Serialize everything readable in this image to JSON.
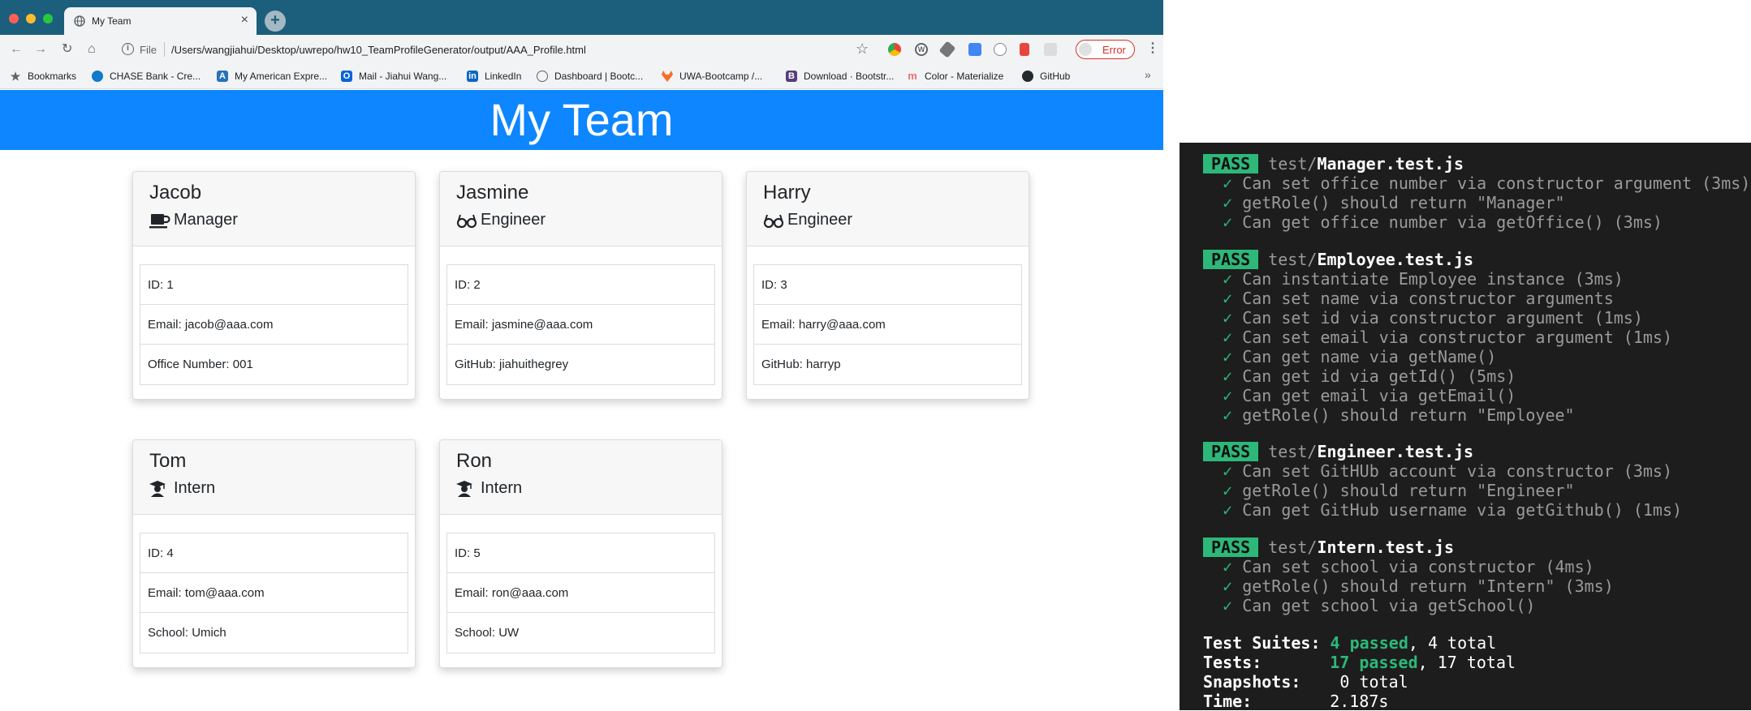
{
  "browser": {
    "tab_title": "My Team",
    "new_tab_label": "+",
    "file_label": "File",
    "url": "/Users/wangjiahui/Desktop/uwrepo/hw10_TeamProfileGenerator/output/AAA_Profile.html",
    "error_label": "Error",
    "bookmarks": [
      {
        "label": "Bookmarks",
        "icon": "star-icon",
        "color": "#5f6368"
      },
      {
        "label": "CHASE Bank - Cre...",
        "icon": "chase-icon",
        "color": "#117aca"
      },
      {
        "label": "My American Expre...",
        "icon": "amex-icon",
        "color": "#2671b9"
      },
      {
        "label": "Mail - Jiahui Wang...",
        "icon": "outlook-icon",
        "color": "#0a64d6"
      },
      {
        "label": "LinkedIn",
        "icon": "linkedin-icon",
        "color": "#0a66c2"
      },
      {
        "label": "Dashboard | Bootc...",
        "icon": "globe-icon",
        "color": "#5f6368"
      },
      {
        "label": "UWA-Bootcamp /...",
        "icon": "gitlab-icon",
        "color": "#fc6d26"
      },
      {
        "label": "Download · Bootstr...",
        "icon": "bootstrap-icon",
        "color": "#563d7c"
      },
      {
        "label": "Color - Materialize",
        "icon": "materialize-icon",
        "color": "#ee6e73"
      },
      {
        "label": "GitHub",
        "icon": "github-icon",
        "color": "#24292e"
      }
    ],
    "more_label": "»"
  },
  "page": {
    "title": "My Team",
    "header_color": "#0d86ff"
  },
  "team": [
    {
      "name": "Jacob",
      "role": "Manager",
      "icon": "coffee-mug-icon",
      "id_line": "ID: 1",
      "email_line": "Email: jacob@aaa.com",
      "extra_line": "Office Number: 001"
    },
    {
      "name": "Jasmine",
      "role": "Engineer",
      "icon": "glasses-icon",
      "id_line": "ID: 2",
      "email_line": "Email: jasmine@aaa.com",
      "extra_line": "GitHub: jiahuithegrey"
    },
    {
      "name": "Harry",
      "role": "Engineer",
      "icon": "glasses-icon",
      "id_line": "ID: 3",
      "email_line": "Email: harry@aaa.com",
      "extra_line": "GitHub: harryp"
    },
    {
      "name": "Tom",
      "role": "Intern",
      "icon": "graduate-icon",
      "id_line": "ID: 4",
      "email_line": "Email: tom@aaa.com",
      "extra_line": "School: Umich"
    },
    {
      "name": "Ron",
      "role": "Intern",
      "icon": "graduate-icon",
      "id_line": "ID: 5",
      "email_line": "Email: ron@aaa.com",
      "extra_line": "School: UW"
    }
  ],
  "terminal": {
    "suites": [
      {
        "badge": "PASS",
        "dir": "test/",
        "file": "Manager.test.js",
        "tests": [
          "Can set office number via constructor argument (3ms)",
          "getRole() should return \"Manager\"",
          "Can get office number via getOffice() (3ms)"
        ]
      },
      {
        "badge": "PASS",
        "dir": "test/",
        "file": "Employee.test.js",
        "tests": [
          "Can instantiate Employee instance (3ms)",
          "Can set name via constructor arguments",
          "Can set id via constructor argument (1ms)",
          "Can set email via constructor argument (1ms)",
          "Can get name via getName()",
          "Can get id via getId() (5ms)",
          "Can get email via getEmail()",
          "getRole() should return \"Employee\""
        ]
      },
      {
        "badge": "PASS",
        "dir": "test/",
        "file": "Engineer.test.js",
        "tests": [
          "Can set GitHUb account via constructor (3ms)",
          "getRole() should return \"Engineer\"",
          "Can get GitHub username via getGithub() (1ms)"
        ]
      },
      {
        "badge": "PASS",
        "dir": "test/",
        "file": "Intern.test.js",
        "tests": [
          "Can set school via constructor (4ms)",
          "getRole() should return \"Intern\" (3ms)",
          "Can get school via getSchool()"
        ]
      }
    ],
    "check_mark": "✓",
    "summary": {
      "suites_label": "Test Suites:",
      "suites_passed": "4 passed",
      "suites_total": ", 4 total",
      "tests_label": "Tests:",
      "tests_passed": "17 passed",
      "tests_total": ", 17 total",
      "snapshots_label": "Snapshots:",
      "snapshots_value": "0 total",
      "time_label": "Time:",
      "time_value": "2.187s"
    }
  }
}
